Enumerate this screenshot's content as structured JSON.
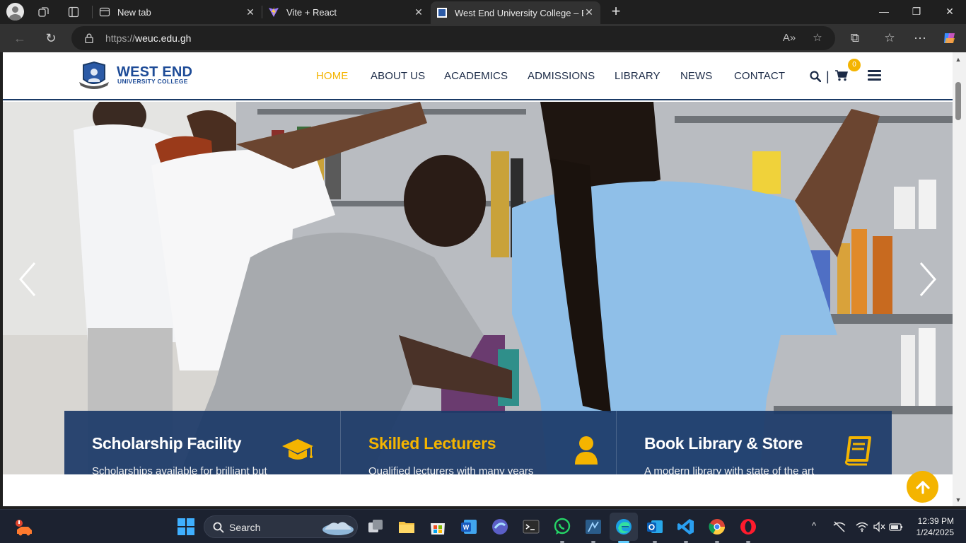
{
  "browser": {
    "tabs": [
      {
        "title": "New tab",
        "active": false
      },
      {
        "title": "Vite + React",
        "active": false
      },
      {
        "title": "West End University College – Bri",
        "active": true
      }
    ],
    "url_scheme": "https://",
    "url_host": "weuc.edu.gh"
  },
  "site": {
    "brand_name": "WEST END",
    "brand_sub": "UNIVERSITY COLLEGE",
    "menu": [
      "HOME",
      "ABOUT US",
      "ACADEMICS",
      "ADMISSIONS",
      "LIBRARY",
      "NEWS",
      "CONTACT"
    ],
    "active_menu": "HOME",
    "cart_count": "0",
    "divider": "|"
  },
  "features": [
    {
      "title": "Scholarship Facility",
      "text": "Scholarships available for  brilliant but needy students.",
      "icon": "graduation-cap-icon"
    },
    {
      "title": "Skilled Lecturers",
      "text": "Qualified lecturers with many years teaching experience.",
      "icon": "user-icon"
    },
    {
      "title": "Book Library & Store",
      "text": "A modern library with state of the art technology.",
      "icon": "book-icon"
    }
  ],
  "taskbar": {
    "search_label": "Search",
    "time": "12:39 PM",
    "date": "1/24/2025"
  },
  "colors": {
    "accent": "#f4b400",
    "brand_blue": "#1d4b97",
    "feature_bg": "#1c3a68"
  }
}
